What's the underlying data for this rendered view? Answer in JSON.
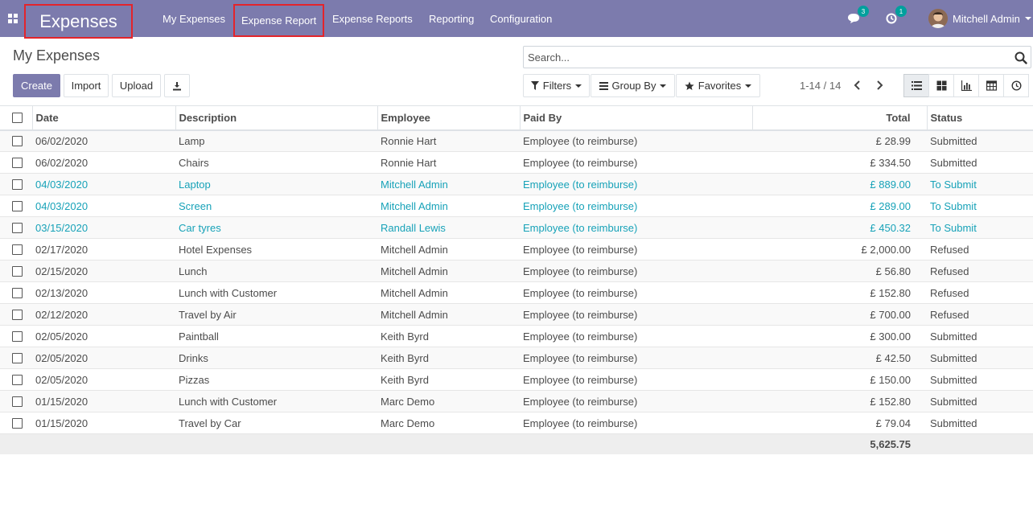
{
  "navbar": {
    "brand": "Expenses",
    "menu": [
      "My Expenses",
      "Expense Report",
      "Expense Reports",
      "Reporting",
      "Configuration"
    ],
    "messages_count": "3",
    "activities_count": "1",
    "user_name": "Mitchell Admin"
  },
  "control_panel": {
    "title": "My Expenses",
    "search_placeholder": "Search...",
    "buttons": {
      "create": "Create",
      "import": "Import",
      "upload": "Upload"
    },
    "filters": "Filters",
    "group_by": "Group By",
    "favorites": "Favorites",
    "pager": "1-14 / 14"
  },
  "table": {
    "columns": [
      "Date",
      "Description",
      "Employee",
      "Paid By",
      "Total",
      "Status"
    ],
    "rows": [
      {
        "date": "06/02/2020",
        "description": "Lamp",
        "employee": "Ronnie Hart",
        "paid_by": "Employee (to reimburse)",
        "total": "£ 28.99",
        "status": "Submitted",
        "draft": false
      },
      {
        "date": "06/02/2020",
        "description": "Chairs",
        "employee": "Ronnie Hart",
        "paid_by": "Employee (to reimburse)",
        "total": "£ 334.50",
        "status": "Submitted",
        "draft": false
      },
      {
        "date": "04/03/2020",
        "description": "Laptop",
        "employee": "Mitchell Admin",
        "paid_by": "Employee (to reimburse)",
        "total": "£ 889.00",
        "status": "To Submit",
        "draft": true
      },
      {
        "date": "04/03/2020",
        "description": "Screen",
        "employee": "Mitchell Admin",
        "paid_by": "Employee (to reimburse)",
        "total": "£ 289.00",
        "status": "To Submit",
        "draft": true
      },
      {
        "date": "03/15/2020",
        "description": "Car tyres",
        "employee": "Randall Lewis",
        "paid_by": "Employee (to reimburse)",
        "total": "£ 450.32",
        "status": "To Submit",
        "draft": true
      },
      {
        "date": "02/17/2020",
        "description": "Hotel Expenses",
        "employee": "Mitchell Admin",
        "paid_by": "Employee (to reimburse)",
        "total": "£ 2,000.00",
        "status": "Refused",
        "draft": false
      },
      {
        "date": "02/15/2020",
        "description": "Lunch",
        "employee": "Mitchell Admin",
        "paid_by": "Employee (to reimburse)",
        "total": "£ 56.80",
        "status": "Refused",
        "draft": false
      },
      {
        "date": "02/13/2020",
        "description": "Lunch with Customer",
        "employee": "Mitchell Admin",
        "paid_by": "Employee (to reimburse)",
        "total": "£ 152.80",
        "status": "Refused",
        "draft": false
      },
      {
        "date": "02/12/2020",
        "description": "Travel by Air",
        "employee": "Mitchell Admin",
        "paid_by": "Employee (to reimburse)",
        "total": "£ 700.00",
        "status": "Refused",
        "draft": false
      },
      {
        "date": "02/05/2020",
        "description": "Paintball",
        "employee": "Keith Byrd",
        "paid_by": "Employee (to reimburse)",
        "total": "£ 300.00",
        "status": "Submitted",
        "draft": false
      },
      {
        "date": "02/05/2020",
        "description": "Drinks",
        "employee": "Keith Byrd",
        "paid_by": "Employee (to reimburse)",
        "total": "£ 42.50",
        "status": "Submitted",
        "draft": false
      },
      {
        "date": "02/05/2020",
        "description": "Pizzas",
        "employee": "Keith Byrd",
        "paid_by": "Employee (to reimburse)",
        "total": "£ 150.00",
        "status": "Submitted",
        "draft": false
      },
      {
        "date": "01/15/2020",
        "description": "Lunch with Customer",
        "employee": "Marc Demo",
        "paid_by": "Employee (to reimburse)",
        "total": "£ 152.80",
        "status": "Submitted",
        "draft": false
      },
      {
        "date": "01/15/2020",
        "description": "Travel by Car",
        "employee": "Marc Demo",
        "paid_by": "Employee (to reimburse)",
        "total": "£ 79.04",
        "status": "Submitted",
        "draft": false
      }
    ],
    "footer_total": "5,625.75"
  },
  "colors": {
    "navbar": "#7c7bad",
    "highlight_box": "#e3242b",
    "draft_row_text": "#17a2b8",
    "badge": "#00a09d"
  },
  "icons": [
    "apps-grid-icon",
    "chat-bubble-icon",
    "clock-activity-icon",
    "search-icon",
    "download-icon",
    "filter-icon",
    "group-by-icon",
    "star-icon",
    "chevron-left-icon",
    "chevron-right-icon",
    "list-view-icon",
    "kanban-view-icon",
    "graph-view-icon",
    "pivot-view-icon",
    "activity-view-icon"
  ]
}
